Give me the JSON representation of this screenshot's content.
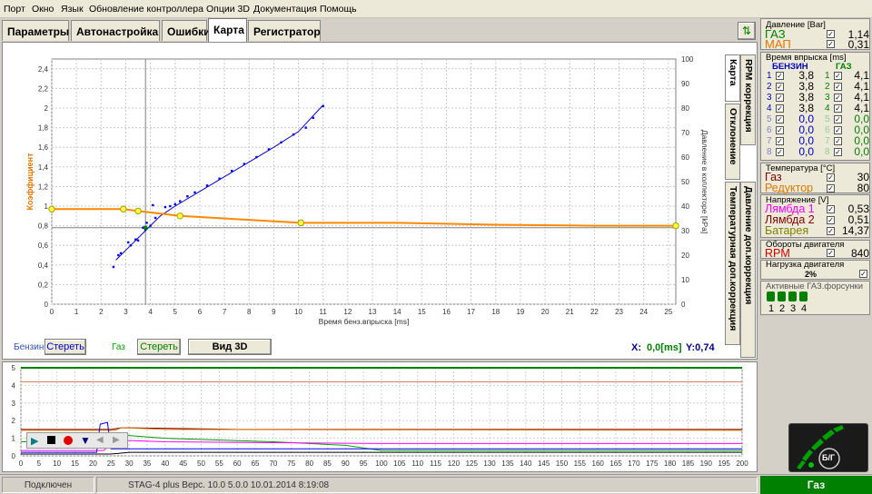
{
  "menu": [
    "Порт",
    "Окно",
    "Язык",
    "Обновление контроллера",
    "Опции 3D",
    "Документация",
    "Помощь"
  ],
  "tabs": [
    "Параметры",
    "Автонастройка",
    "Ошибки",
    "Карта",
    "Регистратор"
  ],
  "vertical_tabs": [
    "Карта",
    "RPM коррекция",
    "Отклонение",
    "Температурная доп.коррекция",
    "Давление доп.коррекция"
  ],
  "controls": {
    "benzin_label": "Бензин",
    "benzin_clear": "Стереть",
    "gas_label": "Газ",
    "gas_clear": "Стереть",
    "view3d": "Вид 3D",
    "x_label": "X:",
    "x_value": "0,0[ms]",
    "y_label": "Y:0,74"
  },
  "chart_data": [
    {
      "type": "scatter+line",
      "xlabel": "Время бенз.впрыска [ms]",
      "ylabel_left": "Коэффициент",
      "ylabel_right": "Давление в коллекторе [kPa]",
      "xlim": [
        0,
        25.3
      ],
      "ylim_left": [
        0,
        2.5
      ],
      "ylim_right": [
        0,
        100
      ],
      "x_ticks": [
        0,
        1,
        2,
        3,
        4,
        5,
        6,
        7,
        8,
        9,
        10,
        11,
        12,
        13,
        14,
        15,
        16,
        17,
        18,
        19,
        20,
        21,
        22,
        23,
        24,
        25
      ],
      "y_ticks_left": [
        0,
        0.2,
        0.4,
        0.6,
        0.8,
        1,
        1.2,
        1.4,
        1.6,
        1.8,
        2,
        2.2,
        2.4
      ],
      "y_ticks_left_labels": [
        "0",
        "0,2",
        "0,4",
        "0,6",
        "0,8",
        "1",
        "1,2",
        "1,4",
        "1,6",
        "1,8",
        "2",
        "2,2",
        "2,4"
      ],
      "y_ticks_right": [
        0,
        10,
        20,
        30,
        40,
        50,
        60,
        70,
        80,
        90,
        100
      ],
      "grid": true,
      "cursor_x": 3.8,
      "cursor_y": 0.78,
      "series": [
        {
          "kind": "scatter",
          "color": "#0000ff",
          "points": [
            [
              2.5,
              0.38
            ],
            [
              2.7,
              0.5
            ],
            [
              2.8,
              0.52
            ],
            [
              3.1,
              0.63
            ],
            [
              3.2,
              0.6
            ],
            [
              3.4,
              0.66
            ],
            [
              3.5,
              0.65
            ],
            [
              3.7,
              0.78
            ],
            [
              3.8,
              0.76
            ],
            [
              3.85,
              0.83
            ],
            [
              4.0,
              0.8
            ],
            [
              4.1,
              1.01
            ],
            [
              4.2,
              0.88
            ],
            [
              4.6,
              0.99
            ],
            [
              4.8,
              1.0
            ],
            [
              5.0,
              1.02
            ],
            [
              5.2,
              1.05
            ],
            [
              5.5,
              1.1
            ],
            [
              5.8,
              1.14
            ],
            [
              6.3,
              1.21
            ],
            [
              6.8,
              1.28
            ],
            [
              7.3,
              1.36
            ],
            [
              7.8,
              1.43
            ],
            [
              8.3,
              1.5
            ],
            [
              8.8,
              1.58
            ],
            [
              9.3,
              1.65
            ],
            [
              9.8,
              1.73
            ],
            [
              10.3,
              1.8
            ],
            [
              10.6,
              1.9
            ],
            [
              11.0,
              2.02
            ]
          ]
        },
        {
          "kind": "fit",
          "color": "#0000cc",
          "points": [
            [
              2.6,
              0.45
            ],
            [
              3.2,
              0.6
            ],
            [
              3.8,
              0.75
            ],
            [
              4.4,
              0.9
            ],
            [
              5.0,
              1.0
            ],
            [
              6.0,
              1.15
            ],
            [
              7.0,
              1.3
            ],
            [
              8.0,
              1.45
            ],
            [
              9.0,
              1.6
            ],
            [
              10.0,
              1.76
            ],
            [
              11.0,
              2.03
            ]
          ]
        },
        {
          "kind": "line",
          "color": "#ff8800",
          "points": [
            [
              0,
              0.97
            ],
            [
              2.9,
              0.97
            ],
            [
              3.5,
              0.95
            ],
            [
              5.2,
              0.9
            ],
            [
              8,
              0.86
            ],
            [
              10.1,
              0.83
            ],
            [
              14,
              0.83
            ],
            [
              18,
              0.81
            ],
            [
              22,
              0.8
            ],
            [
              25.3,
              0.8
            ]
          ],
          "markers": [
            [
              0,
              0.97
            ],
            [
              2.9,
              0.97
            ],
            [
              3.5,
              0.95
            ],
            [
              5.2,
              0.9
            ],
            [
              10.1,
              0.83
            ],
            [
              25.3,
              0.8
            ]
          ]
        }
      ]
    },
    {
      "type": "line",
      "xlim": [
        0,
        200
      ],
      "ylim": [
        0,
        5
      ],
      "x_ticks": [
        0,
        5,
        10,
        15,
        20,
        25,
        30,
        35,
        40,
        45,
        50,
        55,
        60,
        65,
        70,
        75,
        80,
        85,
        90,
        95,
        100,
        105,
        110,
        115,
        120,
        125,
        130,
        135,
        140,
        145,
        150,
        155,
        160,
        165,
        170,
        175,
        180,
        185,
        190,
        195,
        200
      ],
      "y_ticks": [
        0,
        1,
        2,
        3,
        4,
        5
      ],
      "grid": true,
      "series": [
        {
          "color": "#008000",
          "points": [
            [
              0,
              5
            ],
            [
              69,
              5
            ],
            [
              69,
              5
            ],
            [
              200,
              5
            ]
          ]
        },
        {
          "color": "#e08060",
          "points": [
            [
              0,
              4.2
            ],
            [
              50,
              4.2
            ],
            [
              100,
              4.2
            ],
            [
              150,
              4.2
            ],
            [
              200,
              4.2
            ]
          ]
        },
        {
          "color": "#800000",
          "points": [
            [
              0,
              1.5
            ],
            [
              25,
              1.5
            ],
            [
              28,
              1.6
            ],
            [
              60,
              1.5
            ],
            [
              200,
              1.5
            ]
          ]
        },
        {
          "color": "#dd7700",
          "points": [
            [
              0,
              1.45
            ],
            [
              26,
              1.45
            ],
            [
              28,
              1.6
            ],
            [
              40,
              1.5
            ],
            [
              200,
              1.45
            ]
          ]
        },
        {
          "color": "#00a000",
          "points": [
            [
              0,
              0.8
            ],
            [
              24,
              0.8
            ],
            [
              27,
              1.2
            ],
            [
              40,
              1.0
            ],
            [
              70,
              0.8
            ],
            [
              90,
              0.6
            ],
            [
              100,
              0.3
            ],
            [
              200,
              0.3
            ]
          ]
        },
        {
          "color": "#ff00ff",
          "points": [
            [
              0,
              0.3
            ],
            [
              23,
              0.3
            ],
            [
              26,
              0.9
            ],
            [
              40,
              0.8
            ],
            [
              100,
              0.7
            ],
            [
              200,
              0.7
            ]
          ]
        },
        {
          "color": "#0000ff",
          "points": [
            [
              0,
              0.2
            ],
            [
              21,
              0.2
            ],
            [
              22,
              1.8
            ],
            [
              24,
              1.9
            ],
            [
              25,
              0.4
            ],
            [
              200,
              0.4
            ]
          ]
        },
        {
          "color": "#000000",
          "points": [
            [
              0,
              0.1
            ],
            [
              25,
              0.1
            ],
            [
              30,
              0.2
            ],
            [
              200,
              0.2
            ]
          ]
        }
      ]
    }
  ],
  "right_panel": {
    "pressure": {
      "title": "Давление [Bar]",
      "rows": [
        {
          "label": "ГАЗ",
          "value": "1,14",
          "color": "#008000",
          "checked": true
        },
        {
          "label": "МАП",
          "value": "0,31",
          "color": "#dd7700",
          "checked": true
        }
      ]
    },
    "injection": {
      "title": "Время впрыска [ms]",
      "benzin_header": "БЕНЗИН",
      "gas_header": "ГАЗ",
      "rows": [
        {
          "n": "1",
          "benzin": "3,8",
          "gas": "4,1",
          "active": true
        },
        {
          "n": "2",
          "benzin": "3,8",
          "gas": "4,1",
          "active": true
        },
        {
          "n": "3",
          "benzin": "3,8",
          "gas": "4,1",
          "active": true
        },
        {
          "n": "4",
          "benzin": "3,8",
          "gas": "4,1",
          "active": true
        },
        {
          "n": "5",
          "benzin": "0,0",
          "gas": "0,0",
          "active": false
        },
        {
          "n": "6",
          "benzin": "0,0",
          "gas": "0,0",
          "active": false
        },
        {
          "n": "7",
          "benzin": "0,0",
          "gas": "0,0",
          "active": false
        },
        {
          "n": "8",
          "benzin": "0,0",
          "gas": "0,0",
          "active": false
        }
      ]
    },
    "temperature": {
      "title": "Температура [°C]",
      "rows": [
        {
          "label": "Газ",
          "value": "30",
          "color": "#800000"
        },
        {
          "label": "Редуктор",
          "value": "80",
          "color": "#dd7700"
        }
      ]
    },
    "voltage": {
      "title": "Напряжение [V]",
      "rows": [
        {
          "label": "Лямбда 1",
          "value": "0,53",
          "color": "#ff00ff"
        },
        {
          "label": "Лямбда 2",
          "value": "0,51",
          "color": "#800000"
        },
        {
          "label": "Батарея",
          "value": "14,37",
          "color": "#808000"
        }
      ]
    },
    "rpm": {
      "title": "Обороты двигателя",
      "label": "RPM",
      "value": "840",
      "color": "#cc0000"
    },
    "load": {
      "title": "Нагрузка двигателя",
      "value": "2%"
    },
    "injectors": {
      "title": "Активные ГАЗ.форсунки",
      "labels": [
        "1",
        "2",
        "3",
        "4"
      ]
    },
    "mode_label": "Газ",
    "switch_label": "Б/Г"
  },
  "status": {
    "connection": "Подключен",
    "version": "STAG-4 plus   Верс. 10.0  5.0.0    10.01.2014 8:19:08"
  }
}
